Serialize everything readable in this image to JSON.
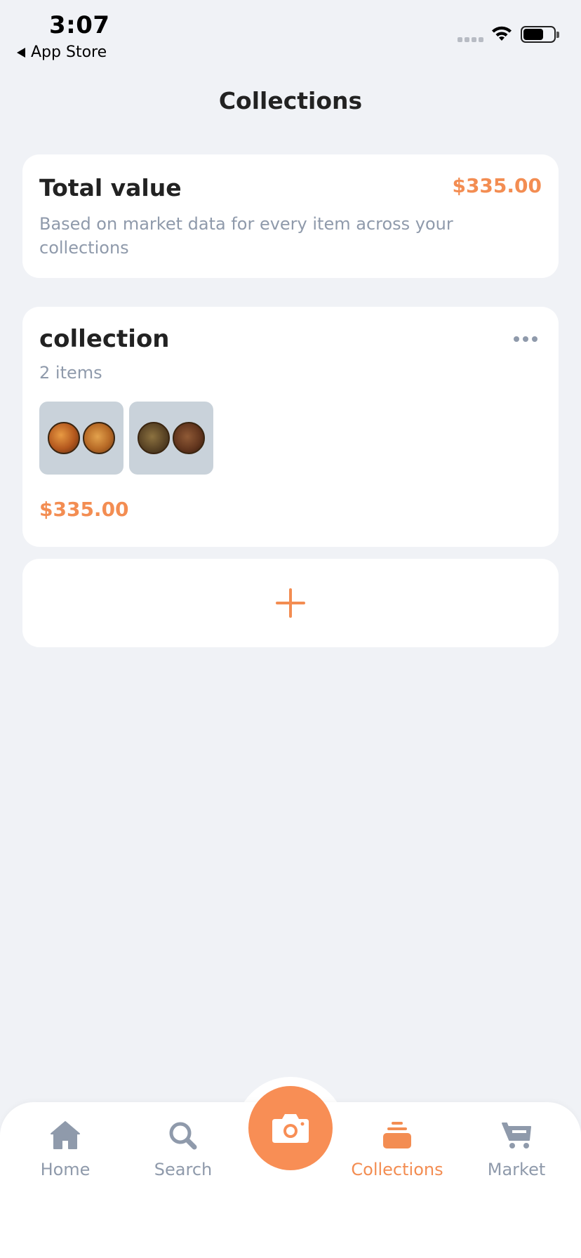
{
  "status_bar": {
    "time": "3:07",
    "back_label": "App Store"
  },
  "page_title": "Collections",
  "total_card": {
    "title": "Total value",
    "value": "$335.00",
    "description": "Based on market data for every item across your collections"
  },
  "collection_card": {
    "name": "collection",
    "item_count": "2 items",
    "value": "$335.00",
    "thumbnails": [
      "coin-pair-1",
      "coin-pair-2"
    ]
  },
  "add_card": {
    "icon": "plus-icon"
  },
  "tabbar": {
    "active": "Collections",
    "items": [
      {
        "label": "Home",
        "icon": "home-icon"
      },
      {
        "label": "Search",
        "icon": "search-icon"
      },
      {
        "label": "Collections",
        "icon": "collections-icon"
      },
      {
        "label": "Market",
        "icon": "cart-icon"
      }
    ],
    "center_button": "camera-icon"
  },
  "colors": {
    "accent": "#f38d52",
    "muted": "#8f9aab",
    "background": "#f0f2f6"
  }
}
